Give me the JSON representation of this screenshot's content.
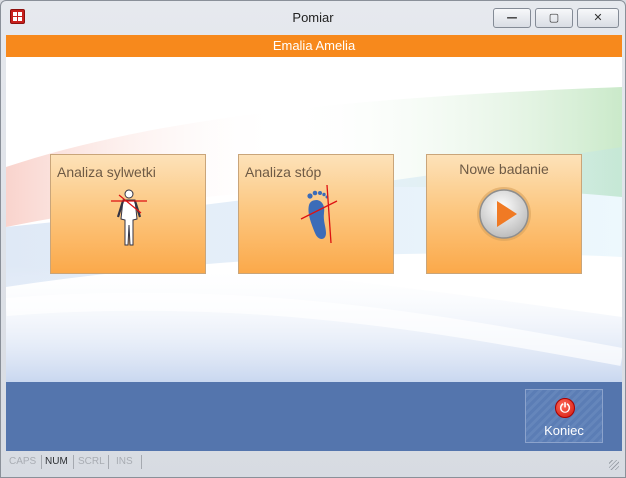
{
  "window": {
    "title": "Pomiar",
    "app_icon": "app-grid-icon",
    "buttons": {
      "minimize": "—",
      "maximize": "▢",
      "close": "✕"
    }
  },
  "banner": {
    "name": "Emalia Amelia"
  },
  "tiles": [
    {
      "label": "Analiza sylwetki",
      "icon": "body-silhouette-icon"
    },
    {
      "label": "Analiza stóp",
      "icon": "footprint-icon"
    },
    {
      "label": "Nowe badanie",
      "icon": "play-icon"
    }
  ],
  "footer": {
    "exit_label": "Koniec",
    "exit_icon": "power-icon",
    "exit_glyph": "⏻"
  },
  "statusbar": {
    "caps": "CAPS",
    "num": "NUM",
    "scrl": "SCRL",
    "ins": "INS"
  },
  "colors": {
    "banner": "#f7891c",
    "footer": "#5475ad",
    "tile_top": "#fde2b9",
    "tile_bottom": "#fba94a",
    "accent_red": "#d3160c"
  }
}
